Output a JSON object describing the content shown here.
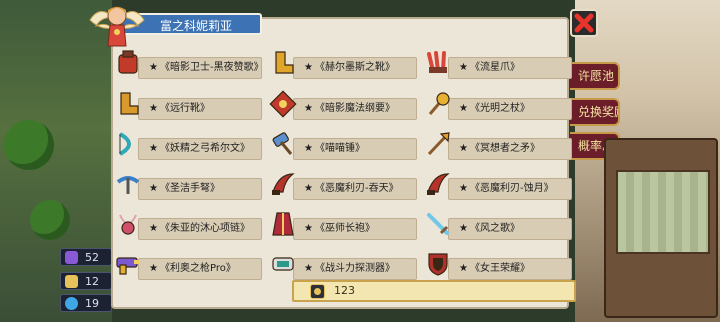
{
  "dialog": {
    "title": "富之科妮莉亚",
    "close_icon": "close-x-icon"
  },
  "side_buttons": [
    "许愿池",
    "兑换奖励",
    "概率总览"
  ],
  "resources": [
    {
      "value": "52",
      "color": "#8a5ad6"
    },
    {
      "value": "12",
      "color": "#e7c15a"
    },
    {
      "value": "19",
      "color": "#3fa7e5"
    }
  ],
  "items": [
    {
      "name": "《暗影卫士-黑夜赞歌》",
      "icon": "armor-icon",
      "color": "#c23a2a"
    },
    {
      "name": "《赫尔墨斯之靴》",
      "icon": "boots-icon",
      "color": "#e0a62a"
    },
    {
      "name": "《流星爪》",
      "icon": "claw-icon",
      "color": "#d8473a"
    },
    {
      "name": "《远行靴》",
      "icon": "boots-icon",
      "color": "#d89a2a"
    },
    {
      "name": "《暗影魔法纲要》",
      "icon": "spellbook-icon",
      "color": "#c0392b"
    },
    {
      "name": "《光明之杖》",
      "icon": "staff-icon",
      "color": "#e6b030"
    },
    {
      "name": "《妖精之弓希尔文》",
      "icon": "bow-icon",
      "color": "#2fa8b8"
    },
    {
      "name": "《喵喵锤》",
      "icon": "hammer-icon",
      "color": "#5a8fd0"
    },
    {
      "name": "《冥想者之矛》",
      "icon": "spear-icon",
      "color": "#e0a030"
    },
    {
      "name": "《圣洁手弩》",
      "icon": "crossbow-icon",
      "color": "#3a7fc8"
    },
    {
      "name": "《恶魔利刃-吞天》",
      "icon": "blade-icon",
      "color": "#b5332a"
    },
    {
      "name": "《恶魔利刃-蚀月》",
      "icon": "blade-icon",
      "color": "#b5332a"
    },
    {
      "name": "《朱亚的沐心项链》",
      "icon": "necklace-icon",
      "color": "#d0506a"
    },
    {
      "name": "《巫师长袍》",
      "icon": "robe-icon",
      "color": "#b02a3a"
    },
    {
      "name": "《风之歌》",
      "icon": "sword-icon",
      "color": "#6ec8e8"
    },
    {
      "name": "《利奥之枪Pro》",
      "icon": "gun-icon",
      "color": "#7a5ad0"
    },
    {
      "name": "《战斗力探测器》",
      "icon": "scanner-icon",
      "color": "#2a9a8a"
    },
    {
      "name": "《女王荣耀》",
      "icon": "shield-icon",
      "color": "#b0302a"
    }
  ],
  "star": "★",
  "cost": {
    "value": "123",
    "icon": "coin-icon"
  }
}
